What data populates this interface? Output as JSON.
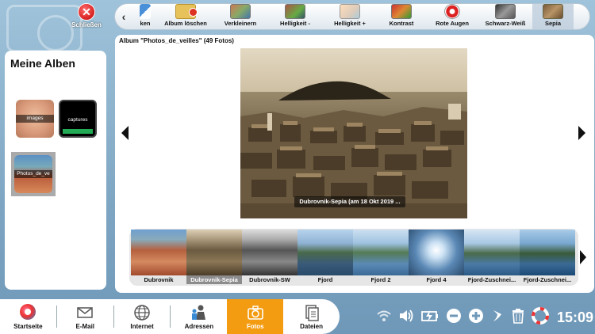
{
  "window": {
    "close_label": "Schließen"
  },
  "toolbar": {
    "items": [
      {
        "label": "ken",
        "icon": "partial-icon"
      },
      {
        "label": "Album löschen",
        "icon": "folder-delete-icon"
      },
      {
        "label": "Verkleinern",
        "icon": "shrink-icon"
      },
      {
        "label": "Helligkeit -",
        "icon": "brightness-down-icon"
      },
      {
        "label": "Helligkeit +",
        "icon": "brightness-up-icon"
      },
      {
        "label": "Kontrast",
        "icon": "contrast-icon"
      },
      {
        "label": "Rote Augen",
        "icon": "red-eye-icon"
      },
      {
        "label": "Schwarz-Weiß",
        "icon": "black-white-icon"
      },
      {
        "label": "Sepia",
        "icon": "sepia-icon"
      }
    ]
  },
  "albums": {
    "title": "Meine Alben",
    "items": [
      {
        "label": "images"
      },
      {
        "label": "captures"
      },
      {
        "label": "Photos_de_ve"
      }
    ]
  },
  "viewer": {
    "album_header": "Album \"Photos_de_veilles\" (49 Fotos)",
    "caption": "Dubrovnik-Sepia (am 18 Okt 2019 ..."
  },
  "filmstrip": {
    "items": [
      {
        "label": "Dubrovnik"
      },
      {
        "label": "Dubrovnik-Sepia"
      },
      {
        "label": "Dubrovnik-SW"
      },
      {
        "label": "Fjord"
      },
      {
        "label": "Fjord 2"
      },
      {
        "label": "Fjord 4"
      },
      {
        "label": "Fjord-Zuschnei..."
      },
      {
        "label": "Fjord-Zuschnei..."
      }
    ]
  },
  "taskbar": {
    "items": [
      {
        "label": "Startseite"
      },
      {
        "label": "E-Mail"
      },
      {
        "label": "Internet"
      },
      {
        "label": "Adressen"
      },
      {
        "label": "Fotos"
      },
      {
        "label": "Dateien"
      }
    ]
  },
  "tray": {
    "clock": "15:09"
  },
  "colors": {
    "accent": "#f39c12",
    "background": "#8fb4cf"
  }
}
